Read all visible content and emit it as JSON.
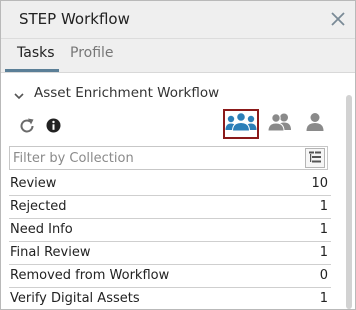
{
  "window": {
    "title": "STEP Workflow",
    "close_icon": "close-icon"
  },
  "tabs": [
    {
      "label": "Tasks",
      "active": true
    },
    {
      "label": "Profile",
      "active": false
    }
  ],
  "section": {
    "title": "Asset Enrichment Workflow",
    "expanded": true
  },
  "toolbar": {
    "refresh_icon": "refresh-icon",
    "info_icon": "info-icon",
    "view_buttons": [
      {
        "icon": "group-users-icon",
        "selected": true
      },
      {
        "icon": "two-users-icon",
        "selected": false
      },
      {
        "icon": "single-user-icon",
        "selected": false
      }
    ]
  },
  "filter": {
    "placeholder": "Filter by Collection",
    "value": ""
  },
  "states": [
    {
      "name": "Review",
      "count": "10"
    },
    {
      "name": "Rejected",
      "count": "1"
    },
    {
      "name": "Need Info",
      "count": "1"
    },
    {
      "name": "Final Review",
      "count": "1"
    },
    {
      "name": "Removed from Workflow",
      "count": "0"
    },
    {
      "name": "Verify Digital Assets",
      "count": "1"
    }
  ],
  "colors": {
    "accent": "#2c7fb8",
    "selected_border": "#8b1a1a",
    "inactive_icon": "#8a8a8a",
    "tab_underline": "#5b7f97"
  }
}
